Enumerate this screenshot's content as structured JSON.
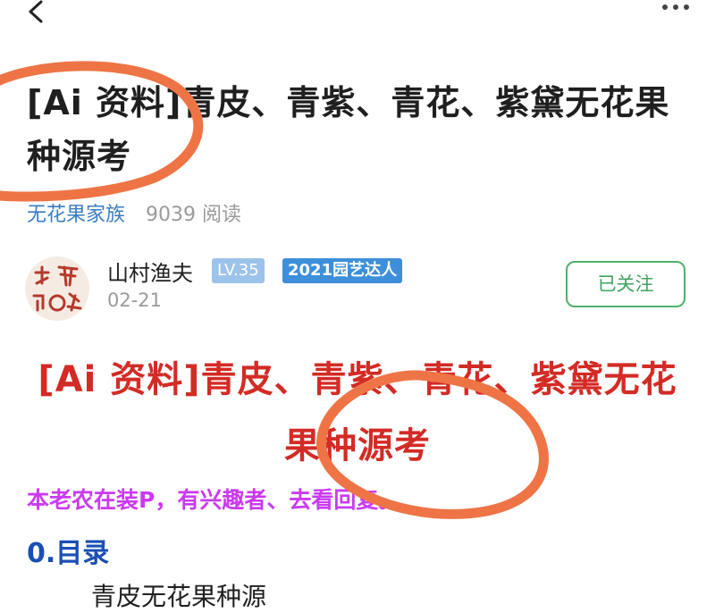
{
  "header": {
    "back_icon": "chevron-left-icon",
    "more_icon": "more-horizontal-icon"
  },
  "post": {
    "title": "[Ai 资料]青皮、青紫、青花、紫黛无花果种源考",
    "group": "无花果家族",
    "reads": "9039 阅读"
  },
  "author": {
    "name": "山村渔夫",
    "level": "LV.35",
    "badge": "2021园艺达人",
    "date": "02-21",
    "follow_label": "已关注"
  },
  "content": {
    "heading": "[Ai 资料]青皮、青紫、青花、紫黛无花果种源考",
    "note": "本老农在装P，有兴趣者、去看回复。",
    "toc": "0.目录",
    "line1": "青皮无花果种源"
  },
  "colors": {
    "heading_red": "#d32b25",
    "note_magenta": "#ca3af0",
    "toc_blue": "#1a4fb5",
    "follow_green": "#4cb169",
    "level_badge": "#9cc3ea",
    "title_badge": "#3d8fd9",
    "annotation_orange": "#ee7446"
  }
}
